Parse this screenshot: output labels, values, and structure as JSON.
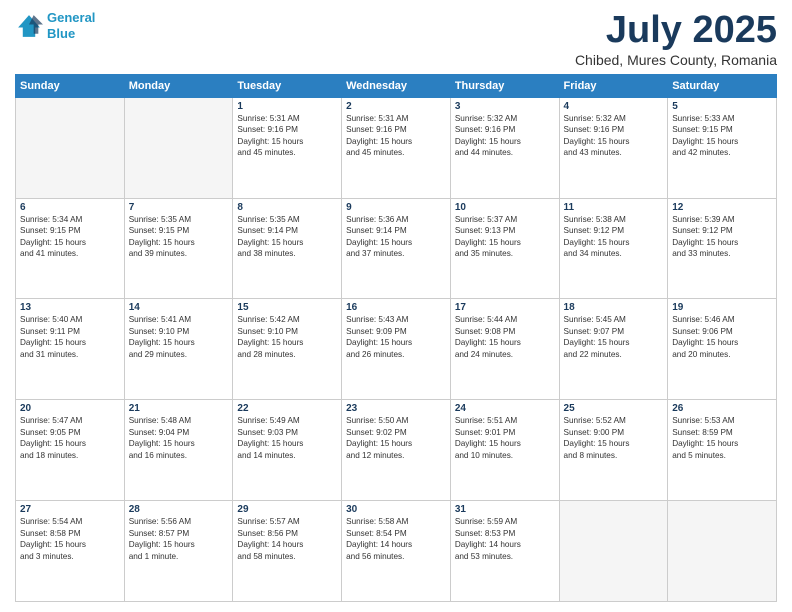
{
  "logo": {
    "line1": "General",
    "line2": "Blue"
  },
  "title": "July 2025",
  "subtitle": "Chibed, Mures County, Romania",
  "weekdays": [
    "Sunday",
    "Monday",
    "Tuesday",
    "Wednesday",
    "Thursday",
    "Friday",
    "Saturday"
  ],
  "weeks": [
    [
      {
        "day": "",
        "info": ""
      },
      {
        "day": "",
        "info": ""
      },
      {
        "day": "1",
        "info": "Sunrise: 5:31 AM\nSunset: 9:16 PM\nDaylight: 15 hours\nand 45 minutes."
      },
      {
        "day": "2",
        "info": "Sunrise: 5:31 AM\nSunset: 9:16 PM\nDaylight: 15 hours\nand 45 minutes."
      },
      {
        "day": "3",
        "info": "Sunrise: 5:32 AM\nSunset: 9:16 PM\nDaylight: 15 hours\nand 44 minutes."
      },
      {
        "day": "4",
        "info": "Sunrise: 5:32 AM\nSunset: 9:16 PM\nDaylight: 15 hours\nand 43 minutes."
      },
      {
        "day": "5",
        "info": "Sunrise: 5:33 AM\nSunset: 9:15 PM\nDaylight: 15 hours\nand 42 minutes."
      }
    ],
    [
      {
        "day": "6",
        "info": "Sunrise: 5:34 AM\nSunset: 9:15 PM\nDaylight: 15 hours\nand 41 minutes."
      },
      {
        "day": "7",
        "info": "Sunrise: 5:35 AM\nSunset: 9:15 PM\nDaylight: 15 hours\nand 39 minutes."
      },
      {
        "day": "8",
        "info": "Sunrise: 5:35 AM\nSunset: 9:14 PM\nDaylight: 15 hours\nand 38 minutes."
      },
      {
        "day": "9",
        "info": "Sunrise: 5:36 AM\nSunset: 9:14 PM\nDaylight: 15 hours\nand 37 minutes."
      },
      {
        "day": "10",
        "info": "Sunrise: 5:37 AM\nSunset: 9:13 PM\nDaylight: 15 hours\nand 35 minutes."
      },
      {
        "day": "11",
        "info": "Sunrise: 5:38 AM\nSunset: 9:12 PM\nDaylight: 15 hours\nand 34 minutes."
      },
      {
        "day": "12",
        "info": "Sunrise: 5:39 AM\nSunset: 9:12 PM\nDaylight: 15 hours\nand 33 minutes."
      }
    ],
    [
      {
        "day": "13",
        "info": "Sunrise: 5:40 AM\nSunset: 9:11 PM\nDaylight: 15 hours\nand 31 minutes."
      },
      {
        "day": "14",
        "info": "Sunrise: 5:41 AM\nSunset: 9:10 PM\nDaylight: 15 hours\nand 29 minutes."
      },
      {
        "day": "15",
        "info": "Sunrise: 5:42 AM\nSunset: 9:10 PM\nDaylight: 15 hours\nand 28 minutes."
      },
      {
        "day": "16",
        "info": "Sunrise: 5:43 AM\nSunset: 9:09 PM\nDaylight: 15 hours\nand 26 minutes."
      },
      {
        "day": "17",
        "info": "Sunrise: 5:44 AM\nSunset: 9:08 PM\nDaylight: 15 hours\nand 24 minutes."
      },
      {
        "day": "18",
        "info": "Sunrise: 5:45 AM\nSunset: 9:07 PM\nDaylight: 15 hours\nand 22 minutes."
      },
      {
        "day": "19",
        "info": "Sunrise: 5:46 AM\nSunset: 9:06 PM\nDaylight: 15 hours\nand 20 minutes."
      }
    ],
    [
      {
        "day": "20",
        "info": "Sunrise: 5:47 AM\nSunset: 9:05 PM\nDaylight: 15 hours\nand 18 minutes."
      },
      {
        "day": "21",
        "info": "Sunrise: 5:48 AM\nSunset: 9:04 PM\nDaylight: 15 hours\nand 16 minutes."
      },
      {
        "day": "22",
        "info": "Sunrise: 5:49 AM\nSunset: 9:03 PM\nDaylight: 15 hours\nand 14 minutes."
      },
      {
        "day": "23",
        "info": "Sunrise: 5:50 AM\nSunset: 9:02 PM\nDaylight: 15 hours\nand 12 minutes."
      },
      {
        "day": "24",
        "info": "Sunrise: 5:51 AM\nSunset: 9:01 PM\nDaylight: 15 hours\nand 10 minutes."
      },
      {
        "day": "25",
        "info": "Sunrise: 5:52 AM\nSunset: 9:00 PM\nDaylight: 15 hours\nand 8 minutes."
      },
      {
        "day": "26",
        "info": "Sunrise: 5:53 AM\nSunset: 8:59 PM\nDaylight: 15 hours\nand 5 minutes."
      }
    ],
    [
      {
        "day": "27",
        "info": "Sunrise: 5:54 AM\nSunset: 8:58 PM\nDaylight: 15 hours\nand 3 minutes."
      },
      {
        "day": "28",
        "info": "Sunrise: 5:56 AM\nSunset: 8:57 PM\nDaylight: 15 hours\nand 1 minute."
      },
      {
        "day": "29",
        "info": "Sunrise: 5:57 AM\nSunset: 8:56 PM\nDaylight: 14 hours\nand 58 minutes."
      },
      {
        "day": "30",
        "info": "Sunrise: 5:58 AM\nSunset: 8:54 PM\nDaylight: 14 hours\nand 56 minutes."
      },
      {
        "day": "31",
        "info": "Sunrise: 5:59 AM\nSunset: 8:53 PM\nDaylight: 14 hours\nand 53 minutes."
      },
      {
        "day": "",
        "info": ""
      },
      {
        "day": "",
        "info": ""
      }
    ]
  ]
}
